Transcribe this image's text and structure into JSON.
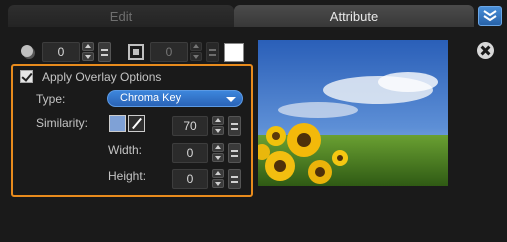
{
  "tabs": [
    {
      "label": "Edit",
      "active": false
    },
    {
      "label": "Attribute",
      "active": true
    }
  ],
  "icons": {
    "collapse": "double-chevron-down-icon",
    "close": "close-circle-icon",
    "shadow": "shadow-icon",
    "border": "border-icon",
    "eyedropper": "eyedropper-icon"
  },
  "top_row": {
    "shadow_value": "0",
    "border_value": "0",
    "border_color": "#ffffff"
  },
  "overlay": {
    "checkbox_label": "Apply Overlay Options",
    "checked": true,
    "type_label": "Type:",
    "type_value": "Chroma Key",
    "similarity_label": "Similarity:",
    "similarity_value": "70",
    "key_color": "#7fa1d6",
    "width_label": "Width:",
    "width_value": "0",
    "height_label": "Height:",
    "height_value": "0"
  },
  "colors": {
    "highlight_border": "#e88b1d",
    "dropdown_blue": "#2f6fc4",
    "active_tab": "#3f3f3f"
  }
}
